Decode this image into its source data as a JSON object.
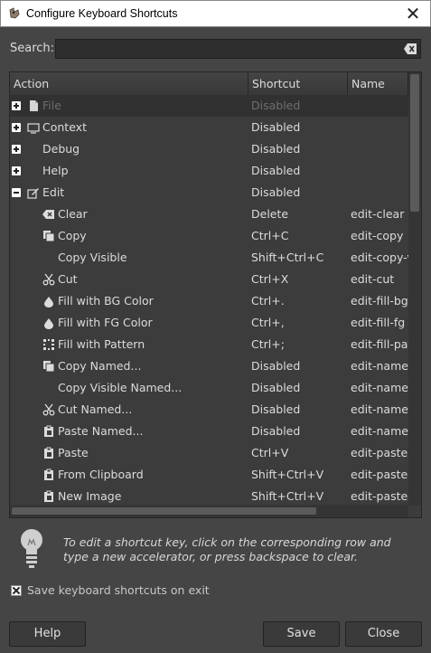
{
  "window": {
    "title": "Configure Keyboard Shortcuts",
    "close_glyph": "✕"
  },
  "search": {
    "label": "Search:",
    "value": "",
    "placeholder": ""
  },
  "columns": {
    "action": "Action",
    "shortcut": "Shortcut",
    "name": "Name"
  },
  "rows": [
    {
      "level": 0,
      "expander": "plus",
      "icon": "file-icon",
      "action": "File",
      "shortcut": "Disabled",
      "name": "",
      "selected": true
    },
    {
      "level": 0,
      "expander": "plus",
      "icon": "context-icon",
      "action": "Context",
      "shortcut": "Disabled",
      "name": ""
    },
    {
      "level": 0,
      "expander": "plus",
      "icon": "",
      "action": "Debug",
      "shortcut": "Disabled",
      "name": ""
    },
    {
      "level": 0,
      "expander": "plus",
      "icon": "",
      "action": "Help",
      "shortcut": "Disabled",
      "name": ""
    },
    {
      "level": 0,
      "expander": "minus",
      "icon": "edit-icon",
      "action": "Edit",
      "shortcut": "Disabled",
      "name": ""
    },
    {
      "level": 1,
      "icon": "clear-icon",
      "action": "Clear",
      "shortcut": "Delete",
      "name": "edit-clear"
    },
    {
      "level": 1,
      "icon": "copy-icon",
      "action": "Copy",
      "shortcut": "Ctrl+C",
      "name": "edit-copy"
    },
    {
      "level": 1,
      "icon": "",
      "action": "Copy Visible",
      "shortcut": "Shift+Ctrl+C",
      "name": "edit-copy-v"
    },
    {
      "level": 1,
      "icon": "cut-icon",
      "action": "Cut",
      "shortcut": "Ctrl+X",
      "name": "edit-cut"
    },
    {
      "level": 1,
      "icon": "fill-icon",
      "action": "Fill with BG Color",
      "shortcut": "Ctrl+.",
      "name": "edit-fill-bg"
    },
    {
      "level": 1,
      "icon": "fill-icon",
      "action": "Fill with FG Color",
      "shortcut": "Ctrl+,",
      "name": "edit-fill-fg"
    },
    {
      "level": 1,
      "icon": "pattern-icon",
      "action": "Fill with Pattern",
      "shortcut": "Ctrl+;",
      "name": "edit-fill-pat"
    },
    {
      "level": 1,
      "icon": "copy-icon",
      "action": "Copy Named...",
      "shortcut": "Disabled",
      "name": "edit-namec"
    },
    {
      "level": 1,
      "icon": "",
      "action": "Copy Visible Named...",
      "shortcut": "Disabled",
      "name": "edit-namec"
    },
    {
      "level": 1,
      "icon": "cut-icon",
      "action": "Cut Named...",
      "shortcut": "Disabled",
      "name": "edit-namec"
    },
    {
      "level": 1,
      "icon": "paste-icon",
      "action": "Paste Named...",
      "shortcut": "Disabled",
      "name": "edit-namec"
    },
    {
      "level": 1,
      "icon": "paste-icon",
      "action": "Paste",
      "shortcut": "Ctrl+V",
      "name": "edit-paste"
    },
    {
      "level": 1,
      "icon": "paste-icon",
      "action": "From Clipboard",
      "shortcut": "Shift+Ctrl+V",
      "name": "edit-paste-"
    },
    {
      "level": 1,
      "icon": "paste-icon",
      "action": "New Image",
      "shortcut": "Shift+Ctrl+V",
      "name": "edit-paste-"
    }
  ],
  "hint": {
    "text": "To edit a shortcut key, click on the corresponding row and type a new accelerator, or press backspace to clear."
  },
  "save_on_exit": {
    "label": "Save keyboard shortcuts on exit",
    "checked": true
  },
  "buttons": {
    "help": "Help",
    "save": "Save",
    "close": "Close"
  }
}
